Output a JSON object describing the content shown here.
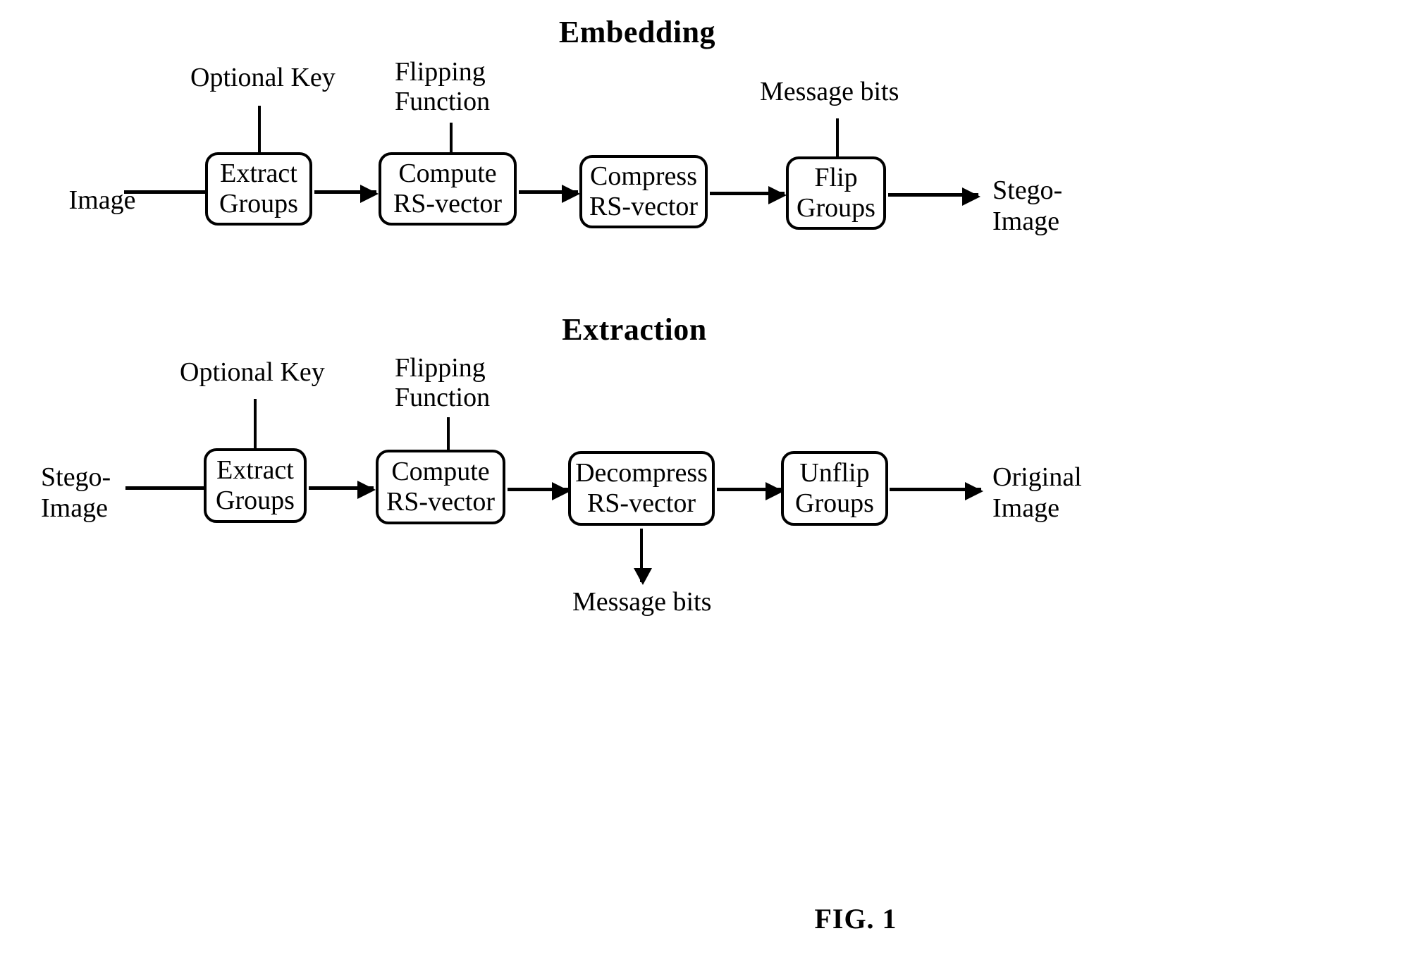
{
  "figure": {
    "caption": "FIG. 1"
  },
  "sections": [
    {
      "title": "Embedding",
      "input_label": "Image",
      "output_label_line1": "Stego-",
      "output_label_line2": "Image",
      "boxes": [
        {
          "line1": "Extract",
          "line2": "Groups"
        },
        {
          "line1": "Compute",
          "line2": "RS-vector"
        },
        {
          "line1": "Compress",
          "line2": "RS-vector"
        },
        {
          "line1": "Flip",
          "line2": "Groups"
        }
      ],
      "top_inputs": [
        {
          "line1": "Optional Key",
          "line2": ""
        },
        {
          "line1": "Flipping",
          "line2": "Function"
        },
        {
          "line1": "Message bits",
          "line2": ""
        }
      ]
    },
    {
      "title": "Extraction",
      "input_label_line1": "Stego-",
      "input_label_line2": "Image",
      "output_label_line1": "Original",
      "output_label_line2": "Image",
      "boxes": [
        {
          "line1": "Extract",
          "line2": "Groups"
        },
        {
          "line1": "Compute",
          "line2": "RS-vector"
        },
        {
          "line1": "Decompress",
          "line2": "RS-vector"
        },
        {
          "line1": "Unflip",
          "line2": "Groups"
        }
      ],
      "top_inputs": [
        {
          "line1": "Optional Key",
          "line2": ""
        },
        {
          "line1": "Flipping",
          "line2": "Function"
        }
      ],
      "bottom_output": "Message bits"
    }
  ],
  "colors": {
    "stroke": "#000000",
    "background": "#ffffff"
  }
}
